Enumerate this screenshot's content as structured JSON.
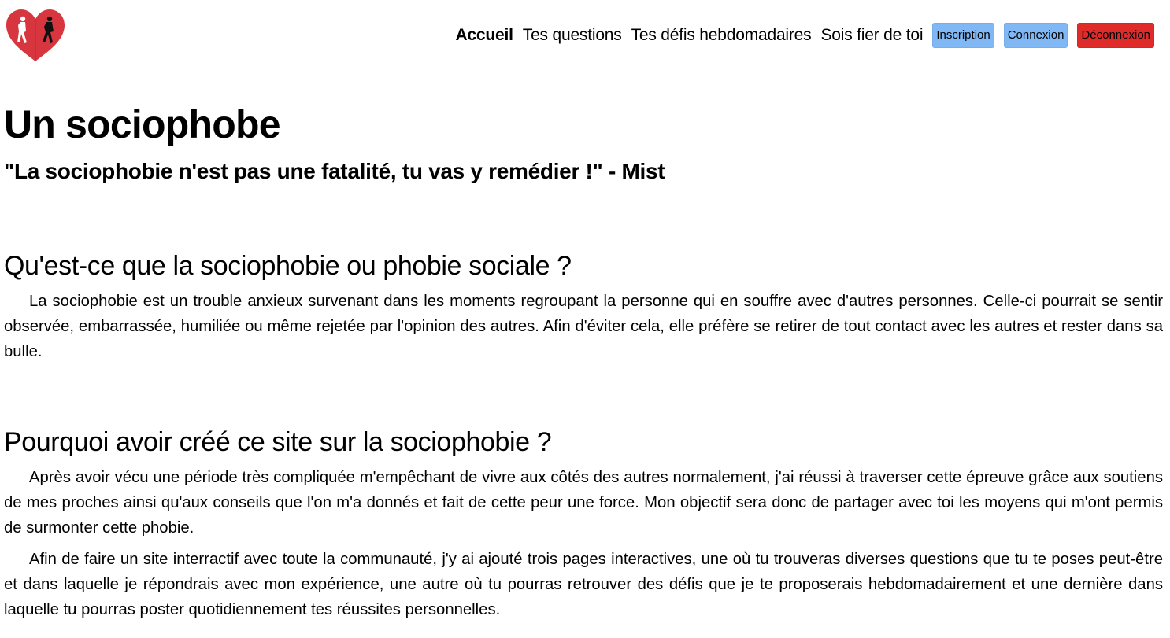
{
  "header": {
    "logo_icon": "heart-with-two-figures-logo",
    "nav": {
      "home": "Accueil",
      "questions": "Tes questions",
      "challenges": "Tes défis hebdomadaires",
      "proud": "Sois fier de toi"
    },
    "buttons": {
      "signup": "Inscription",
      "login": "Connexion",
      "logout": "Déconnexion"
    }
  },
  "colors": {
    "signup_bg": "#7fb8f5",
    "login_bg": "#7fb8f5",
    "logout_bg": "#e02b2b",
    "logo_red": "#d8363e"
  },
  "main": {
    "title": "Un sociophobe",
    "quote": "\"La sociophobie n'est pas une fatalité, tu vas y remédier !\" - Mist",
    "sections": [
      {
        "heading": "Qu'est-ce que la sociophobie ou phobie sociale ?",
        "paragraphs": [
          "La sociophobie est un trouble anxieux survenant dans les moments regroupant la personne qui en souffre avec d'autres personnes. Celle-ci pourrait se sentir observée, embarrassée, humiliée ou même rejetée par l'opinion des autres. Afin d'éviter cela, elle préfère se retirer de tout contact avec les autres et rester dans sa bulle."
        ]
      },
      {
        "heading": "Pourquoi avoir créé ce site sur la sociophobie ?",
        "paragraphs": [
          "Après avoir vécu une période très compliquée m'empêchant de vivre aux côtés des autres normalement, j'ai réussi à traverser cette épreuve grâce aux soutiens de mes proches ainsi qu'aux conseils que l'on m'a donnés et fait de cette peur une force. Mon objectif sera donc de partager avec toi les moyens qui m'ont permis de surmonter cette phobie.",
          "Afin de faire un site interractif avec toute la communauté, j'y ai ajouté trois pages interactives, une où tu trouveras diverses questions que tu te poses peut-être et dans laquelle je répondrais avec mon expérience, une autre où tu pourras retrouver des défis que je te proposerais hebdomadairement et une dernière dans laquelle tu pourras poster quotidiennement tes réussites personnelles."
        ]
      }
    ]
  }
}
